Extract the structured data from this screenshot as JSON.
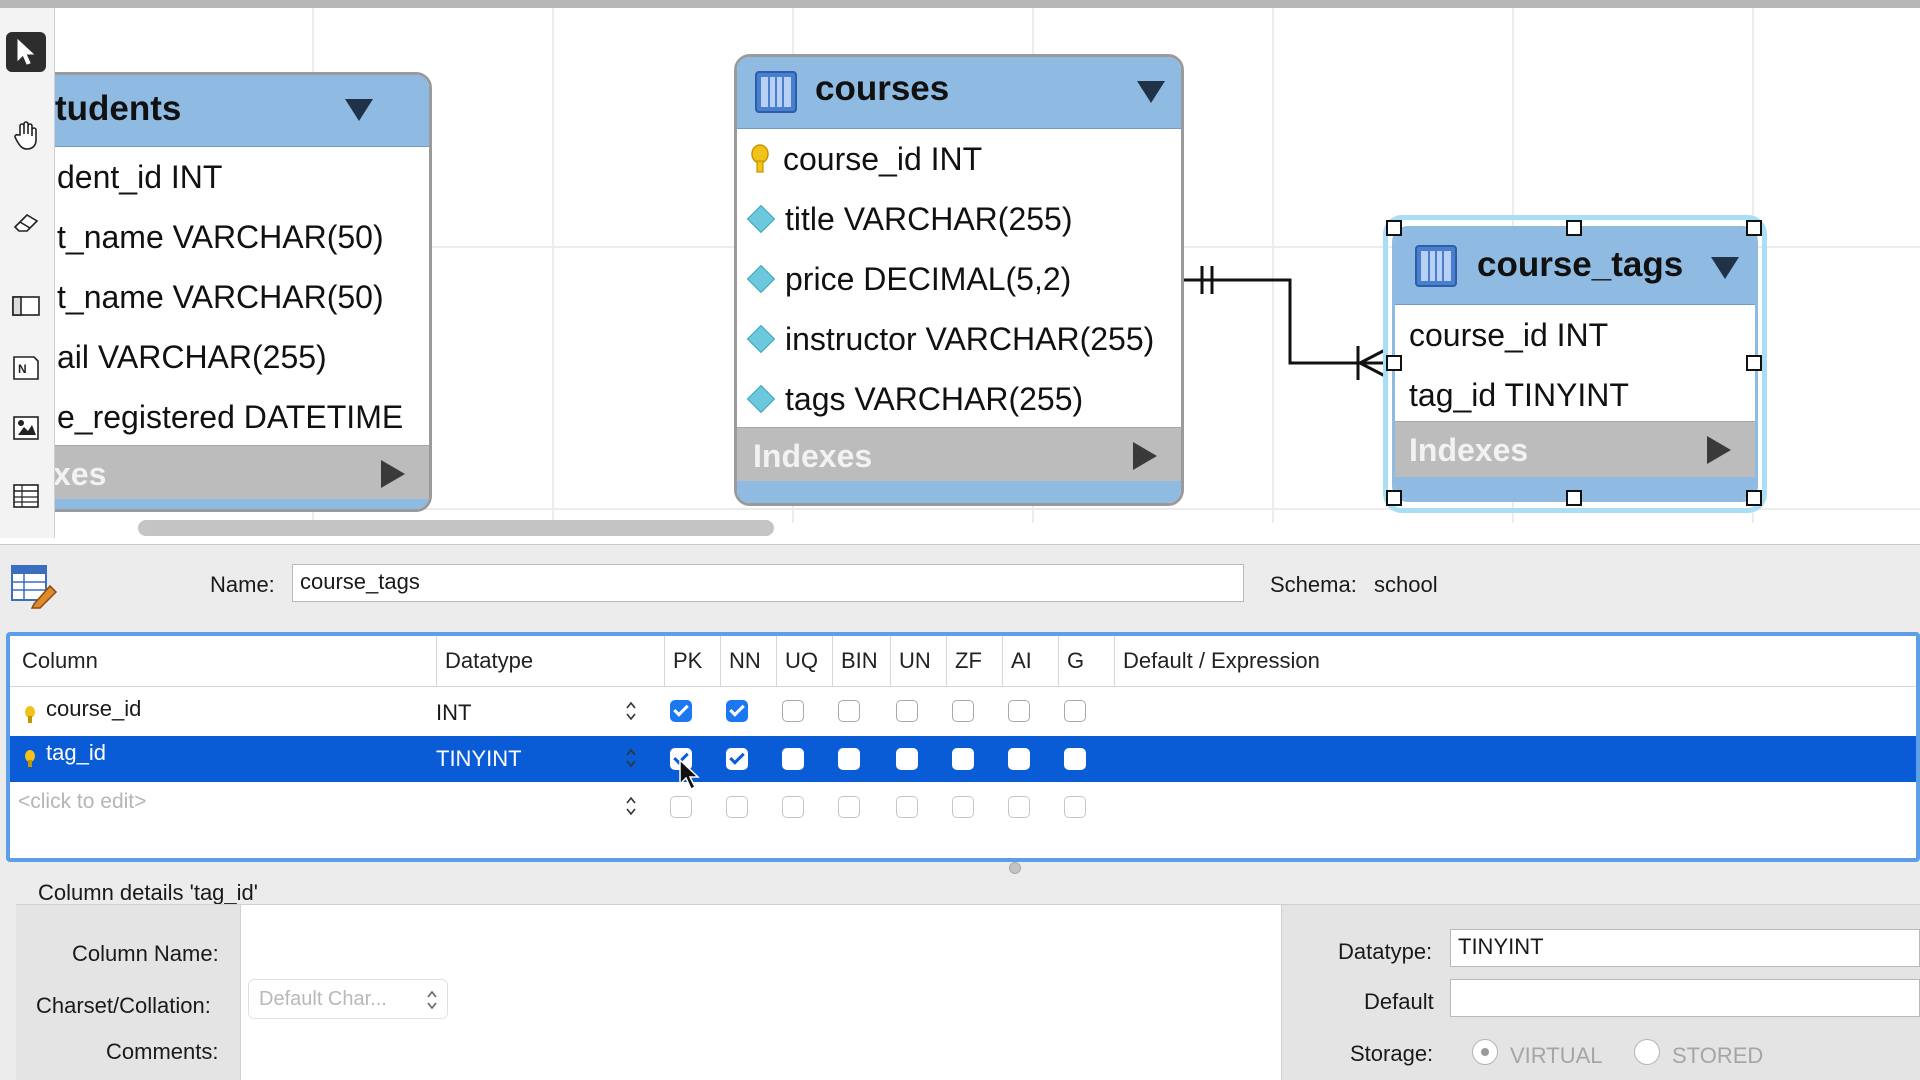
{
  "toolbar": {
    "tools": [
      "pointer-tool",
      "hand-tool",
      "eraser-tool",
      "layer-tool",
      "note-tool",
      "image-tool",
      "table-tool"
    ]
  },
  "diagram": {
    "tables": [
      {
        "name": "tudents",
        "columns": [
          {
            "text": "dent_id INT",
            "icon": "none"
          },
          {
            "text": "t_name VARCHAR(50)",
            "icon": "none"
          },
          {
            "text": "t_name VARCHAR(50)",
            "icon": "none"
          },
          {
            "text": "ail VARCHAR(255)",
            "icon": "none"
          },
          {
            "text": "e_registered DATETIME",
            "icon": "none"
          }
        ],
        "indexes_label": "xes"
      },
      {
        "name": "courses",
        "columns": [
          {
            "text": "course_id INT",
            "icon": "key-icon"
          },
          {
            "text": "title VARCHAR(255)",
            "icon": "diamond-icon"
          },
          {
            "text": "price DECIMAL(5,2)",
            "icon": "diamond-icon"
          },
          {
            "text": "instructor VARCHAR(255)",
            "icon": "diamond-icon"
          },
          {
            "text": "tags VARCHAR(255)",
            "icon": "diamond-icon"
          }
        ],
        "indexes_label": "Indexes"
      },
      {
        "name": "course_tags",
        "columns": [
          {
            "text": "course_id INT",
            "icon": "none"
          },
          {
            "text": "tag_id TINYINT",
            "icon": "none"
          }
        ],
        "indexes_label": "Indexes"
      }
    ],
    "relationship": {
      "from": "courses",
      "to": "course_tags",
      "type": "one-to-many"
    }
  },
  "editor": {
    "name_label": "Name:",
    "name_value": "course_tags",
    "schema_label": "Schema:",
    "schema_value": "school",
    "grid": {
      "headers": [
        "Column",
        "Datatype",
        "PK",
        "NN",
        "UQ",
        "BIN",
        "UN",
        "ZF",
        "AI",
        "G",
        "Default / Expression"
      ],
      "rows": [
        {
          "column": "course_id",
          "datatype": "INT",
          "flags": [
            true,
            true,
            false,
            false,
            false,
            false,
            false,
            false
          ],
          "selected": false
        },
        {
          "column": "tag_id",
          "datatype": "TINYINT",
          "flags": [
            true,
            true,
            false,
            false,
            false,
            false,
            false,
            false
          ],
          "selected": true
        }
      ],
      "placeholder": "<click to edit>"
    },
    "details": {
      "title": "Column details 'tag_id'",
      "column_name_label": "Column Name:",
      "charset_label": "Charset/Collation:",
      "charset_placeholder": "Default Char...",
      "comments_label": "Comments:",
      "datatype_label": "Datatype:",
      "datatype_value": "TINYINT",
      "default_label": "Default",
      "storage_label": "Storage:",
      "storage_options": [
        "VIRTUAL",
        "STORED"
      ],
      "storage_selected": "VIRTUAL"
    }
  },
  "colors": {
    "table_header": "#8fbbe3",
    "selection": "#0a5bd6",
    "checkbox_on": "#1c78f0",
    "focus_border": "#5c9fe8"
  }
}
